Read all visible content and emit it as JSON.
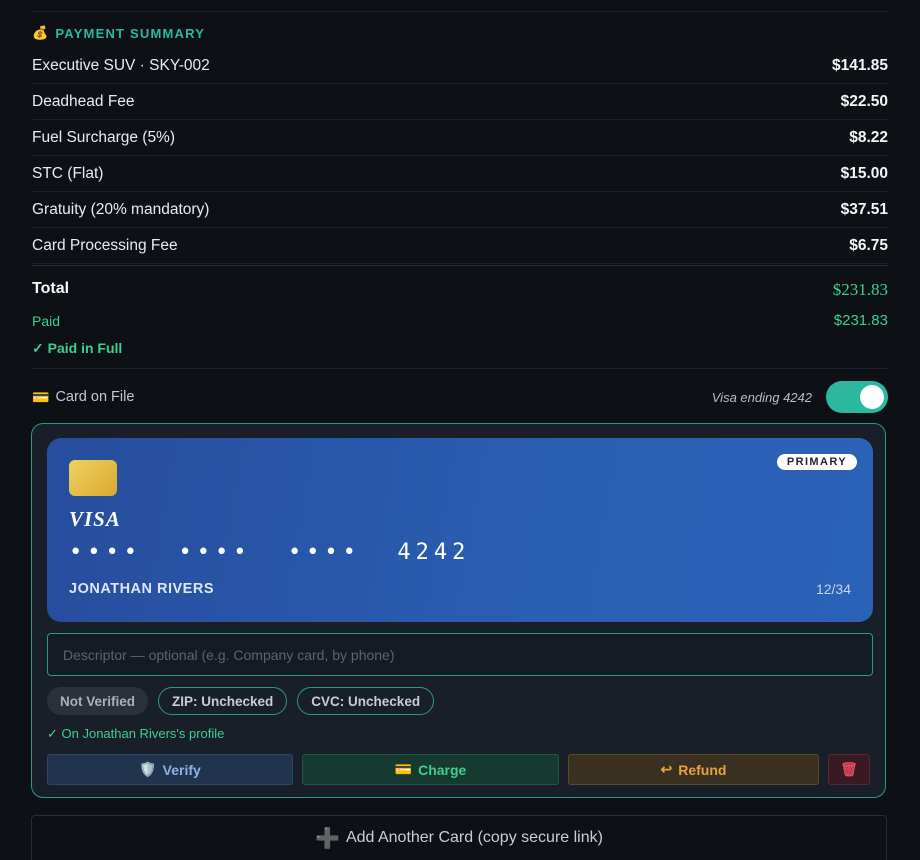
{
  "summary": {
    "heading": "PAYMENT SUMMARY",
    "heading_icon": "money-bag-icon",
    "lines": [
      {
        "label": "Executive SUV · SKY-002",
        "amount": "$141.85"
      },
      {
        "label": "Deadhead Fee",
        "amount": "$22.50"
      },
      {
        "label": "Fuel Surcharge (5%)",
        "amount": "$8.22"
      },
      {
        "label": "STC (Flat)",
        "amount": "$15.00"
      },
      {
        "label": "Gratuity (20% mandatory)",
        "amount": "$37.51"
      },
      {
        "label": "Card Processing Fee",
        "amount": "$6.75"
      }
    ],
    "total_label": "Total",
    "total_amount": "$231.83",
    "paid_label": "Paid",
    "paid_amount": "$231.83",
    "paid_status": "✓ Paid in Full"
  },
  "card_on_file": {
    "label": "Card on File",
    "icon": "credit-card-icon",
    "summary": "Visa ending 4242",
    "toggle_on": true
  },
  "card": {
    "badge": "PRIMARY",
    "brand": "VISA",
    "number": "••••  ••••  ••••  4242",
    "holder": "JONATHAN RIVERS",
    "expiry": "12/34"
  },
  "descriptor": {
    "placeholder": "Descriptor — optional (e.g. Company card, by phone)",
    "value": ""
  },
  "badges": {
    "verified": "Not Verified",
    "zip": "ZIP: Unchecked",
    "cvc": "CVC: Unchecked"
  },
  "profile_note": "✓ On Jonathan Rivers's profile",
  "actions": {
    "verify": "Verify",
    "charge": "Charge",
    "refund": "Refund",
    "delete_icon": "trash-icon"
  },
  "add_card": "Add Another Card (copy secure link)",
  "colors": {
    "accent_teal": "#2bb7a0",
    "success_green": "#3ecf8e",
    "card_blue": "#2a5eb2",
    "refund_orange": "#e8a23c",
    "danger_red": "#e04a5e"
  }
}
